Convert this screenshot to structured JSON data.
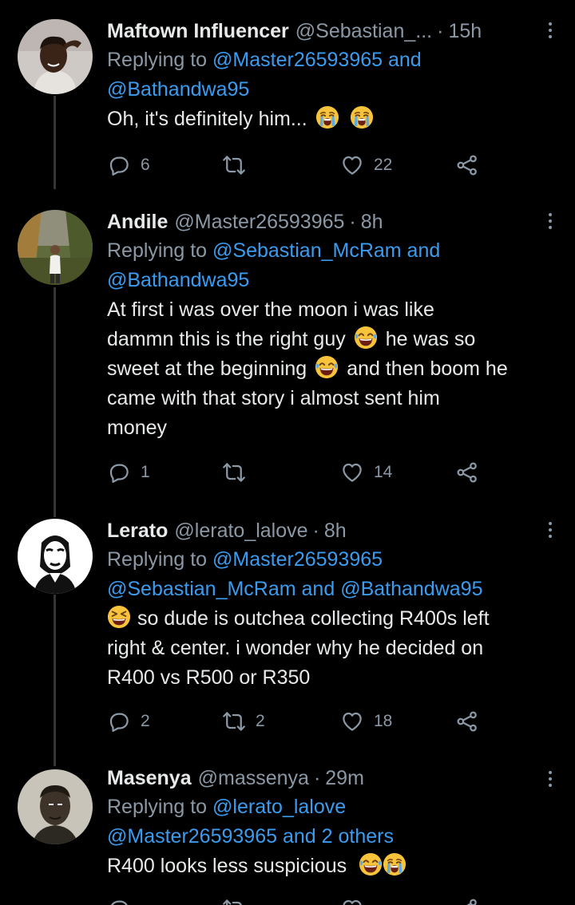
{
  "tweets": [
    {
      "name": "Maftown Influencer",
      "handle": "@Sebastian_...",
      "time": "15h",
      "replying_label": "Replying to",
      "replying_to": "@Master26593965 and",
      "replying_to_2": "@Bathandwa95",
      "text_1": "Oh, it's definitely him...",
      "replies": "6",
      "retweets": "",
      "likes": "22"
    },
    {
      "name": "Andile",
      "handle": "@Master26593965",
      "time": "8h",
      "replying_label": "Replying to",
      "replying_to": "@Sebastian_McRam and",
      "replying_to_2": "@Bathandwa95",
      "line_1": "At first i was over the moon i was like",
      "line_2a": "dammn this is the right guy",
      "line_2b": "he was so",
      "line_3a": "sweet at the beginning",
      "line_3b": "and then boom he",
      "line_4": "came with that story i almost sent him",
      "line_5": "money",
      "replies": "1",
      "retweets": "",
      "likes": "14"
    },
    {
      "name": "Lerato",
      "handle": "@lerato_lalove",
      "time": "8h",
      "replying_label": "Replying to",
      "replying_to": "@Master26593965",
      "replying_to_2": "@Sebastian_McRam and @Bathandwa95",
      "line_1": "so dude is outchea collecting R400s left",
      "line_2": "right & center. i wonder why he decided on",
      "line_3": "R400 vs R500 or R350",
      "replies": "2",
      "retweets": "2",
      "likes": "18"
    },
    {
      "name": "Masenya",
      "handle": "@massenya",
      "time": "29m",
      "replying_label": "Replying to",
      "replying_to": "@lerato_lalove",
      "replying_to_2": "@Master26593965 and 2 others",
      "text_1": "R400 looks less suspicious"
    }
  ],
  "separator": "·",
  "icons": {
    "reply": "reply-icon",
    "retweet": "retweet-icon",
    "like": "heart-icon",
    "share": "share-icon",
    "more": "more-icon"
  },
  "colors": {
    "background": "#000000",
    "text": "#e7e9ea",
    "secondary": "#8b98a5",
    "link": "#3b9cef",
    "thread_line": "#333639"
  }
}
